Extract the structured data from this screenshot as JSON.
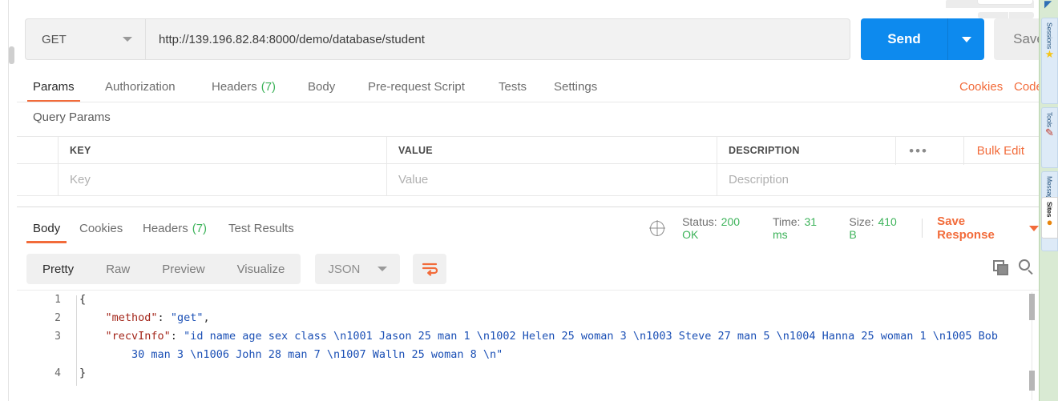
{
  "request": {
    "method": "GET",
    "url": "http://139.196.82.84:8000/demo/database/student",
    "send_label": "Send",
    "save_label": "Save",
    "tabs": [
      {
        "label": "Params",
        "active": true,
        "count": ""
      },
      {
        "label": "Authorization",
        "active": false,
        "count": ""
      },
      {
        "label": "Headers",
        "active": false,
        "count": "(7)"
      },
      {
        "label": "Body",
        "active": false,
        "count": ""
      },
      {
        "label": "Pre-request Script",
        "active": false,
        "count": ""
      },
      {
        "label": "Tests",
        "active": false,
        "count": ""
      },
      {
        "label": "Settings",
        "active": false,
        "count": ""
      }
    ],
    "cookies_link": "Cookies",
    "code_link": "Code"
  },
  "query_params": {
    "title": "Query Params",
    "columns": [
      "KEY",
      "VALUE",
      "DESCRIPTION"
    ],
    "rows": [
      {
        "key": "Key",
        "value": "Value",
        "description": "Description"
      }
    ],
    "more_menu": "•••",
    "bulk_edit": "Bulk Edit"
  },
  "response": {
    "tabs": [
      {
        "label": "Body",
        "active": true,
        "count": ""
      },
      {
        "label": "Cookies",
        "active": false,
        "count": ""
      },
      {
        "label": "Headers",
        "active": false,
        "count": "(7)"
      },
      {
        "label": "Test Results",
        "active": false,
        "count": ""
      }
    ],
    "status_label": "Status:",
    "status_value": "200 OK",
    "time_label": "Time:",
    "time_value": "31 ms",
    "size_label": "Size:",
    "size_value": "410 B",
    "save_response": "Save Response",
    "viewers": [
      {
        "label": "Pretty",
        "active": true
      },
      {
        "label": "Raw",
        "active": false
      },
      {
        "label": "Preview",
        "active": false
      },
      {
        "label": "Visualize",
        "active": false
      }
    ],
    "format": "JSON",
    "body_lines": [
      {
        "n": "1",
        "segments": [
          {
            "t": "{",
            "c": "p"
          }
        ]
      },
      {
        "n": "2",
        "segments": [
          {
            "t": "    ",
            "c": "p"
          },
          {
            "t": "\"method\"",
            "c": "k"
          },
          {
            "t": ": ",
            "c": "p"
          },
          {
            "t": "\"get\"",
            "c": "v"
          },
          {
            "t": ",",
            "c": "p"
          }
        ]
      },
      {
        "n": "3",
        "segments": [
          {
            "t": "    ",
            "c": "p"
          },
          {
            "t": "\"recvInfo\"",
            "c": "k"
          },
          {
            "t": ": ",
            "c": "p"
          },
          {
            "t": "\"id name age sex class \\n1001 Jason 25 man 1 \\n1002 Helen 25 woman 3 \\n1003 Steve 27 man 5 \\n1004 Hanna 25 woman 1 \\n1005 Bob",
            "c": "v"
          }
        ]
      },
      {
        "n": "",
        "segments": [
          {
            "t": "        ",
            "c": "p"
          },
          {
            "t": "30 man 3 \\n1006 John 28 man 7 \\n1007 Walln 25 woman 8 \\n\"",
            "c": "v"
          }
        ]
      },
      {
        "n": "4",
        "segments": [
          {
            "t": "}",
            "c": "p"
          }
        ]
      }
    ]
  },
  "browser_sidebar": {
    "tabs": [
      {
        "label": "Sessions",
        "icon": "★",
        "icon_color": "#f5c518",
        "white": false
      },
      {
        "label": "Tools",
        "icon": "🖌",
        "icon_color": "#c0392b",
        "white": false
      },
      {
        "label": "Messages",
        "icon": "➤",
        "icon_color": "#2f6fb5",
        "white": false
      },
      {
        "label": "Sites",
        "icon": "●",
        "icon_color": "#e8850c",
        "white": true
      }
    ]
  }
}
